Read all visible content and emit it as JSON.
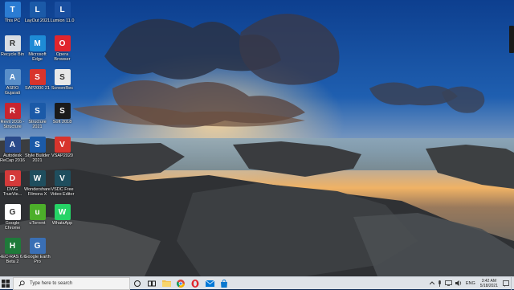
{
  "desktop": {
    "icons": [
      {
        "label": "This PC",
        "icon": "computer-icon",
        "color": "#2b7cd3"
      },
      {
        "label": "Recycle Bin",
        "icon": "recycle-bin-icon",
        "color": "#d9dde3"
      },
      {
        "label": "ASRO Gujarati",
        "icon": "asro-app-icon",
        "color": "#5a8fc9"
      },
      {
        "label": "Revit 2016 - Structure",
        "icon": "revit-icon",
        "color": "#c8242f"
      },
      {
        "label": "Autodesk ReCap 2016",
        "icon": "recap-icon",
        "color": "#2a4a8a"
      },
      {
        "label": "DWG TrueVie...",
        "icon": "dwg-trueview-icon",
        "color": "#d43a3a"
      },
      {
        "label": "Google Chrome",
        "icon": "chrome-icon",
        "color": "#ffffff"
      },
      {
        "label": "HEC-RAS 6.0 Beta 2",
        "icon": "hec-ras-icon",
        "color": "#1f7a3a"
      },
      {
        "label": "LayOut 2021",
        "icon": "layout-icon",
        "color": "#1b5aa8"
      },
      {
        "label": "Microsoft Edge",
        "icon": "edge-icon",
        "color": "#1e8bd6"
      },
      {
        "label": "SAP2000 21",
        "icon": "sap2000-icon",
        "color": "#d8342c"
      },
      {
        "label": "Structure 2021",
        "icon": "structure-icon",
        "color": "#1b5aa8"
      },
      {
        "label": "Style Builder 2021",
        "icon": "style-builder-icon",
        "color": "#1b5aa8"
      },
      {
        "label": "Wondershare Filmora X",
        "icon": "filmora-icon",
        "color": "#1f4e5e"
      },
      {
        "label": "uTorrent",
        "icon": "utorrent-icon",
        "color": "#4caf2a"
      },
      {
        "label": "Google Earth Pro",
        "icon": "google-earth-icon",
        "color": "#3a6fb5"
      },
      {
        "label": "Lumion 11.0",
        "icon": "lumion-icon",
        "color": "#1a4fa0"
      },
      {
        "label": "Opera Browser",
        "icon": "opera-icon",
        "color": "#e1252d"
      },
      {
        "label": "ScreenRec",
        "icon": "screenrec-icon",
        "color": "#e8e8e8"
      },
      {
        "label": "Soft 2018",
        "icon": "soft-icon",
        "color": "#1a1a1a"
      },
      {
        "label": "VSAP2020",
        "icon": "vsap-icon",
        "color": "#d8342c"
      },
      {
        "label": "VSDC Free Video Editor",
        "icon": "vsdc-icon",
        "color": "#1f4e5e"
      },
      {
        "label": "WhatsApp",
        "icon": "whatsapp-icon",
        "color": "#25d366"
      }
    ]
  },
  "taskbar": {
    "search_placeholder": "Type here to search",
    "apps": [
      {
        "name": "task-view-icon"
      },
      {
        "name": "file-explorer-icon"
      },
      {
        "name": "chrome-icon"
      },
      {
        "name": "opera-icon"
      },
      {
        "name": "mail-icon"
      },
      {
        "name": "microsoft-store-icon"
      }
    ],
    "tray": {
      "language": "ENG",
      "time": "3:42 AM",
      "date": "5/18/2021"
    },
    "colors": {
      "background": "#dfe3e8",
      "accent": "#0078d7"
    }
  }
}
